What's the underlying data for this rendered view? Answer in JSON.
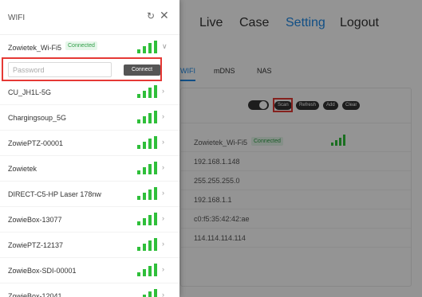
{
  "top_nav": {
    "items": [
      "Live",
      "Case",
      "Setting",
      "Logout"
    ],
    "active": "Setting"
  },
  "sub_tabs": {
    "items": [
      "WIFI",
      "mDNS",
      "NAS"
    ],
    "active": "WIFI"
  },
  "toolbar": {
    "scan": "Scan",
    "refresh": "Refresh",
    "add": "Add",
    "clear": "Clear"
  },
  "current_connection": {
    "ssid": "Zowietek_Wi-Fi5",
    "status": "Connected",
    "rows": [
      "192.168.1.148",
      "255.255.255.0",
      "192.168.1.1",
      "c0:f5:35:42:42:ae",
      "114.114.114.114"
    ]
  },
  "drawer": {
    "title": "WIFI",
    "icons": {
      "refresh": "refresh-icon",
      "close": "close-icon"
    },
    "connected_network": {
      "name": "Zowietek_Wi-Fi5",
      "status": "Connected"
    },
    "password": {
      "placeholder": "Password",
      "value": ""
    },
    "connect_label": "Connect",
    "networks": [
      "CU_JH1L-5G",
      "Chargingsoup_5G",
      "ZowiePTZ-00001",
      "Zowietek",
      "DIRECT-C5-HP Laser 178nw",
      "ZowieBox-13077",
      "ZowiePTZ-12137",
      "ZowieBox-SDI-00001",
      "ZowieBox-12041"
    ]
  },
  "colors": {
    "accent": "#1e88e5",
    "signal": "#2fbf3a",
    "highlight": "#e53935",
    "connected_text": "#2e9e46"
  }
}
